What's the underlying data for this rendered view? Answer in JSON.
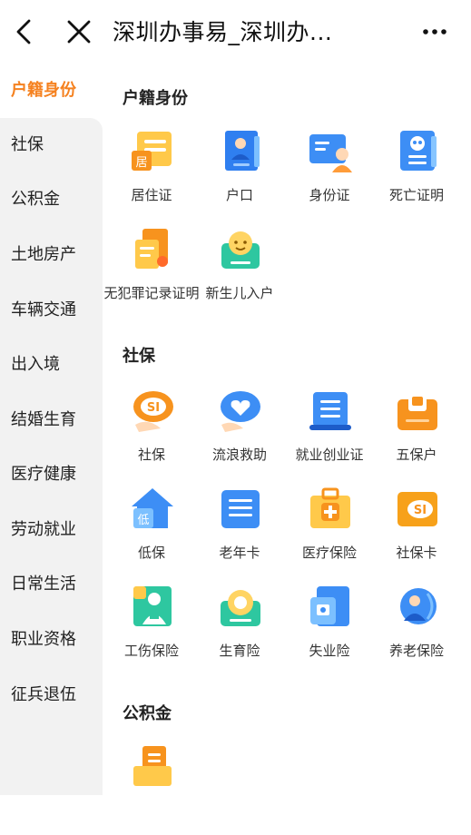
{
  "header": {
    "title": "深圳办事易_深圳办...",
    "back_icon": "chevron-left-icon",
    "close_icon": "close-icon",
    "more_icon": "more-dots-icon"
  },
  "sidebar": {
    "items": [
      {
        "label": "户籍身份",
        "active": true
      },
      {
        "label": "社保"
      },
      {
        "label": "公积金"
      },
      {
        "label": "土地房产"
      },
      {
        "label": "车辆交通"
      },
      {
        "label": "出入境"
      },
      {
        "label": "结婚生育"
      },
      {
        "label": "医疗健康"
      },
      {
        "label": "劳动就业"
      },
      {
        "label": "日常生活"
      },
      {
        "label": "职业资格"
      },
      {
        "label": "征兵退伍"
      }
    ]
  },
  "sections": {
    "huji": {
      "title": "户籍身份",
      "items": [
        {
          "label": "居住证",
          "icon": "residence-permit-icon",
          "badge": "居"
        },
        {
          "label": "户口",
          "icon": "household-register-icon"
        },
        {
          "label": "身份证",
          "icon": "id-card-icon"
        },
        {
          "label": "死亡证明",
          "icon": "death-certificate-icon"
        },
        {
          "label": "无犯罪记录证明",
          "icon": "no-criminal-record-icon"
        },
        {
          "label": "新生儿入户",
          "icon": "newborn-registration-icon"
        }
      ]
    },
    "shebao": {
      "title": "社保",
      "items": [
        {
          "label": "社保",
          "icon": "social-security-icon",
          "badge": "SI"
        },
        {
          "label": "流浪救助",
          "icon": "vagrant-relief-icon"
        },
        {
          "label": "就业创业证",
          "icon": "employment-certificate-icon"
        },
        {
          "label": "五保户",
          "icon": "five-guarantees-icon"
        },
        {
          "label": "低保",
          "icon": "subsistence-allowance-icon",
          "badge": "低"
        },
        {
          "label": "老年卡",
          "icon": "senior-card-icon"
        },
        {
          "label": "医疗保险",
          "icon": "medical-insurance-icon"
        },
        {
          "label": "社保卡",
          "icon": "social-security-card-icon",
          "badge": "SI"
        },
        {
          "label": "工伤保险",
          "icon": "work-injury-insurance-icon"
        },
        {
          "label": "生育险",
          "icon": "maternity-insurance-icon"
        },
        {
          "label": "失业险",
          "icon": "unemployment-insurance-icon"
        },
        {
          "label": "养老保险",
          "icon": "pension-insurance-icon"
        }
      ]
    },
    "gongjijin": {
      "title": "公积金",
      "items": [
        {
          "label": "",
          "icon": "housing-fund-icon"
        }
      ]
    }
  },
  "colors": {
    "accent": "#f5811f",
    "blue": "#3d8ef5",
    "orange": "#f7a11a",
    "yellow": "#ffc94a",
    "green": "#2ec7a0",
    "sidebar_bg": "#f2f2f2"
  }
}
